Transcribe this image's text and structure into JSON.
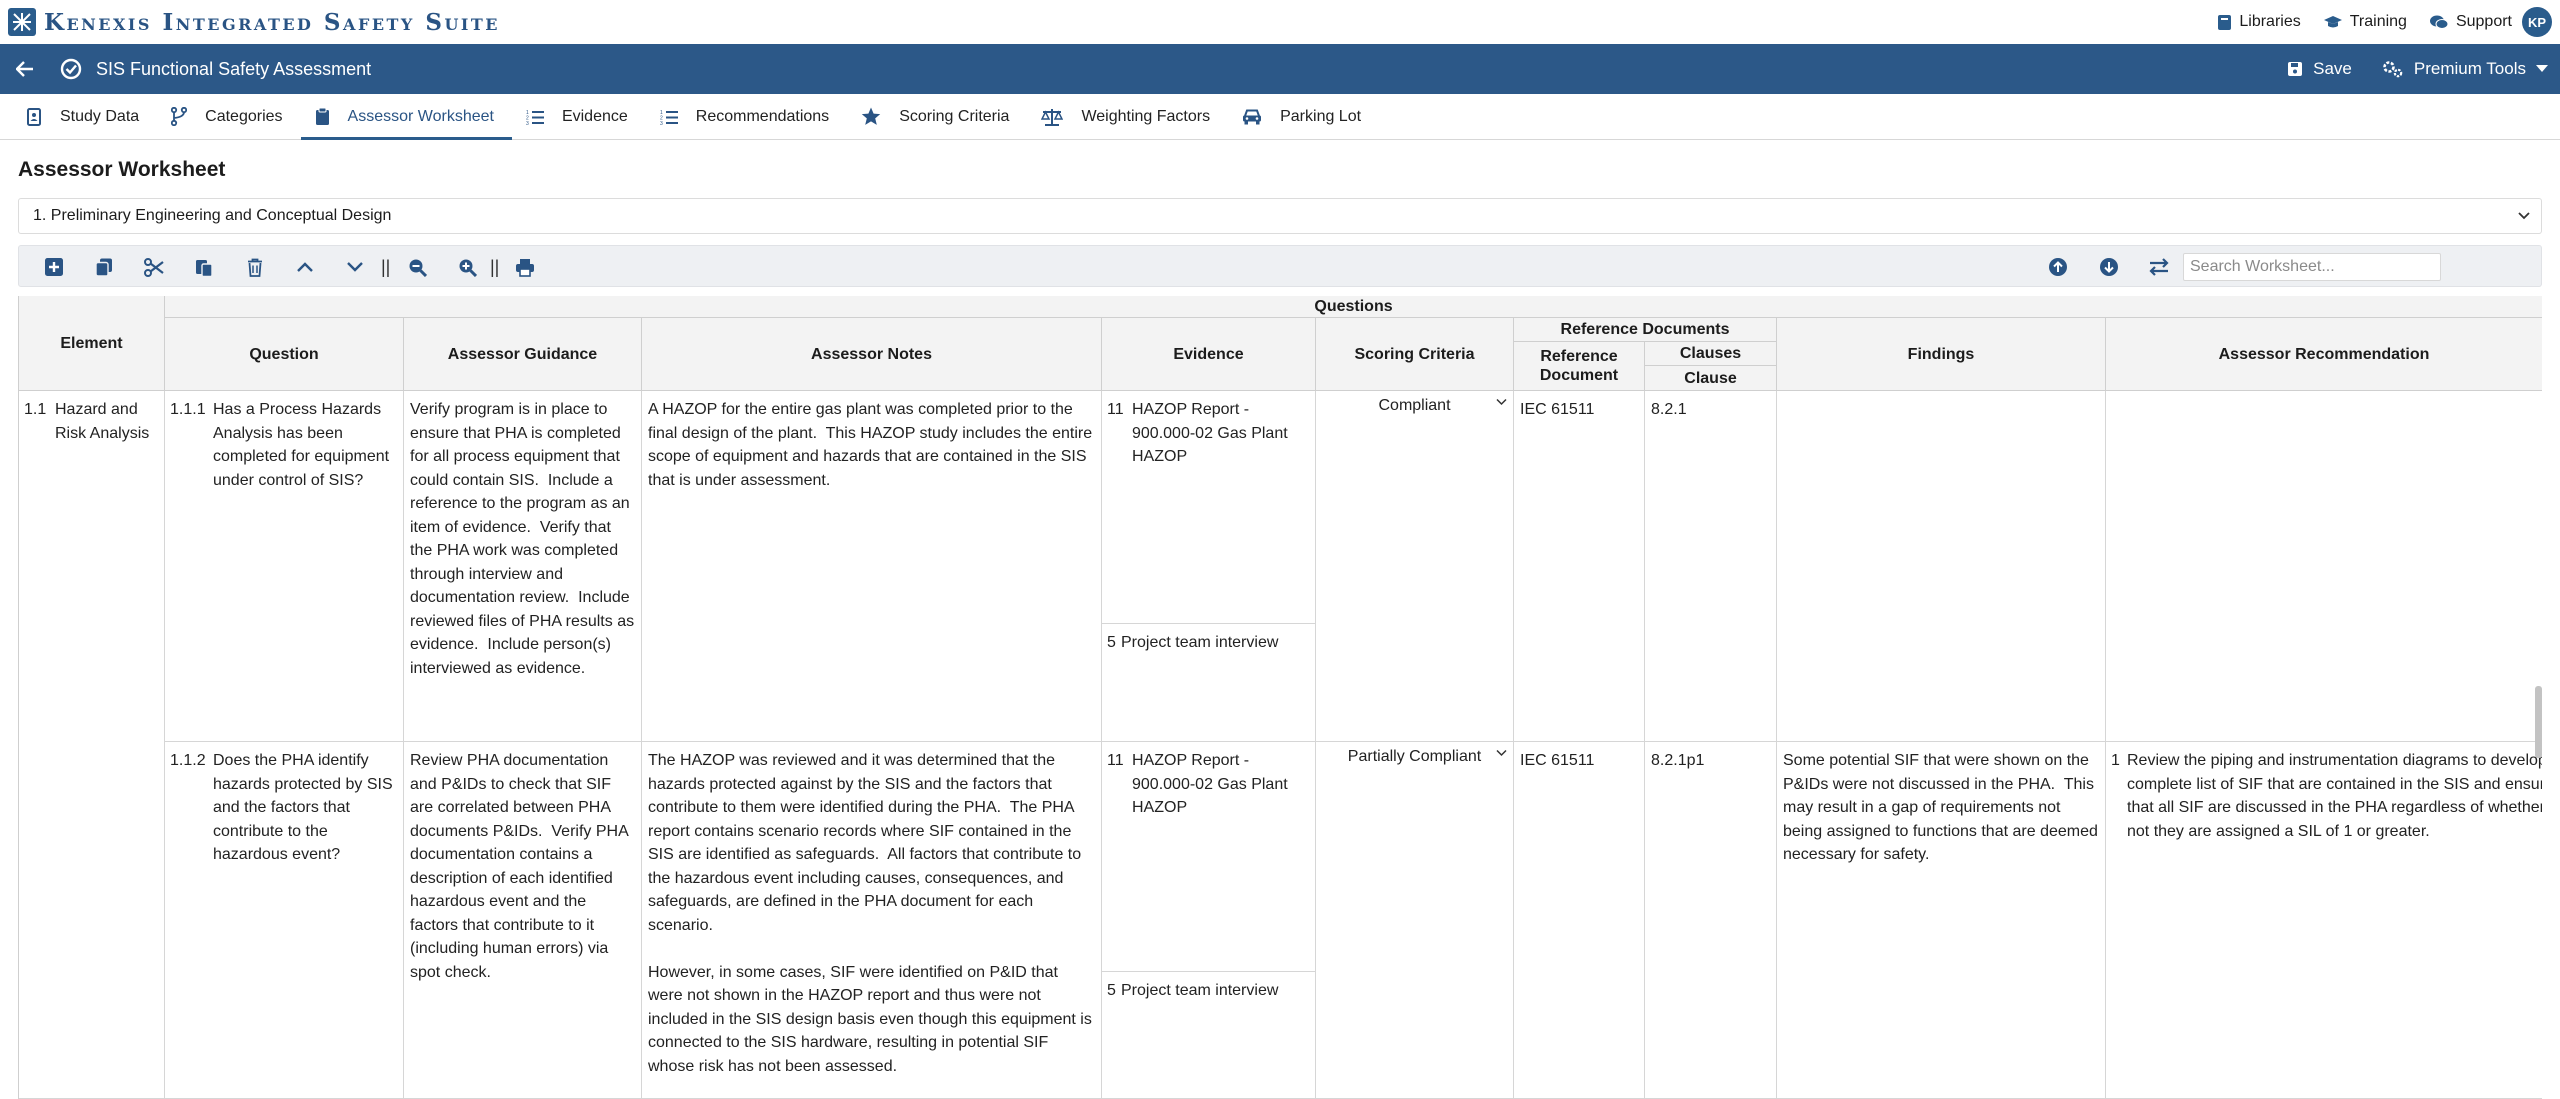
{
  "app": {
    "brand": "Kenexis Integrated Safety Suite",
    "title": "SIS Functional Safety Assessment",
    "user_initials": "KP"
  },
  "top_links": [
    {
      "label": "Libraries",
      "icon": "book-icon"
    },
    {
      "label": "Training",
      "icon": "graduation-cap-icon"
    },
    {
      "label": "Support",
      "icon": "comments-icon"
    }
  ],
  "title_actions": {
    "save_label": "Save",
    "premium_label": "Premium Tools"
  },
  "tabs": [
    {
      "label": "Study Data",
      "icon": "address-book-icon"
    },
    {
      "label": "Categories",
      "icon": "code-branch-icon"
    },
    {
      "label": "Assessor Worksheet",
      "icon": "clipboard-icon",
      "active": true
    },
    {
      "label": "Evidence",
      "icon": "list-ordered-icon"
    },
    {
      "label": "Recommendations",
      "icon": "list-ordered-icon"
    },
    {
      "label": "Scoring Criteria",
      "icon": "star-icon"
    },
    {
      "label": "Weighting Factors",
      "icon": "scale-icon"
    },
    {
      "label": "Parking Lot",
      "icon": "car-icon"
    }
  ],
  "page": {
    "heading": "Assessor Worksheet",
    "section": "1. Preliminary Engineering and Conceptual Design",
    "search_placeholder": "Search Worksheet..."
  },
  "columns": {
    "element": "Element",
    "questions_group": "Questions",
    "question": "Question",
    "guidance": "Assessor Guidance",
    "notes": "Assessor Notes",
    "evidence": "Evidence",
    "scoring": "Scoring Criteria",
    "refdocs_group": "Reference Documents",
    "ref_document": "Reference Document",
    "clauses_group": "Clauses",
    "clause": "Clause",
    "findings": "Findings",
    "recommendation": "Assessor Recommendation"
  },
  "element": {
    "number": "1.1",
    "name": "Hazard and Risk Analysis"
  },
  "rows": [
    {
      "number": "1.1.1",
      "question": "Has a Process Hazards Analysis has been completed for equipment under control of SIS?",
      "guidance": "Verify program is in place to ensure that PHA is completed for all process equipment that could contain SIS.  Include a reference to the program as an item of evidence.  Verify that the PHA work was completed through interview and documentation review.  Include reviewed files of PHA results as evidence.  Include person(s) interviewed as evidence.",
      "notes": "A HAZOP for the entire gas plant was completed prior to the final design of the plant.  This HAZOP study includes the entire scope of equipment and hazards that are contained in the SIS that is under assessment.",
      "evidence": [
        {
          "num": "11",
          "text": "HAZOP Report - 900.000-02 Gas Plant HAZOP"
        },
        {
          "num": "5",
          "text": "Project team interview"
        }
      ],
      "scoring": "Compliant",
      "ref_document": "IEC 61511",
      "clause": "8.2.1",
      "findings": "",
      "recommendation": {
        "num": "",
        "text": ""
      }
    },
    {
      "number": "1.1.2",
      "question": "Does the PHA identify hazards protected by SIS and the factors that contribute to the hazardous event?",
      "guidance": "Review PHA documentation and P&IDs to check that SIF are correlated between PHA documents P&IDs.  Verify PHA documentation contains a description of each identified hazardous event and the factors that contribute to it (including human errors) via spot check.",
      "notes": "The HAZOP was reviewed and it was determined that the hazards protected against by the SIS and the factors that contribute to them were identified during the PHA.  The PHA report contains scenario records where SIF contained in the SIS are identified as safeguards.  All factors that contribute to the hazardous event including causes, consequences, and safeguards, are defined in the PHA document for each scenario.\n\nHowever, in some cases, SIF were identified on P&ID that were not shown in the HAZOP report and thus were not included in the SIS design basis even though this equipment is connected to the SIS hardware, resulting in potential SIF whose risk has not been assessed.",
      "evidence": [
        {
          "num": "11",
          "text": "HAZOP Report - 900.000-02 Gas Plant HAZOP"
        },
        {
          "num": "5",
          "text": "Project team interview"
        }
      ],
      "scoring": "Partially Compliant",
      "ref_document": "IEC 61511",
      "clause": "8.2.1p1",
      "findings": "Some potential SIF that were shown on the P&IDs were not discussed in the PHA.  This may result in a gap of requirements not being assigned to functions that are deemed necessary for safety.",
      "recommendation": {
        "num": "1",
        "text": "Review the piping and instrumentation diagrams to develop a complete list of SIF that are contained in the SIS and ensure that all SIF are discussed in the PHA regardless of whether or not they are assigned a SIL of 1 or greater."
      }
    }
  ]
}
